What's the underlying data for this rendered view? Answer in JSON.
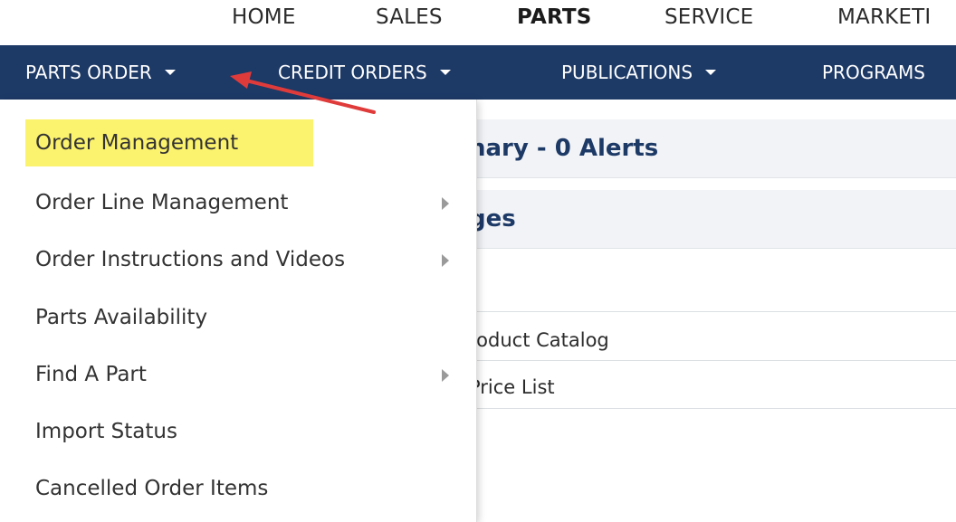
{
  "top_nav": {
    "items": [
      "HOME",
      "SALES",
      "PARTS",
      "SERVICE",
      "MARKETI"
    ],
    "active": "PARTS"
  },
  "sub_nav": {
    "items": [
      "PARTS ORDER",
      "CREDIT ORDERS",
      "PUBLICATIONS",
      "PROGRAMS"
    ]
  },
  "dropdown": {
    "items": [
      {
        "label": "Order Management",
        "has_submenu": false,
        "highlighted": true
      },
      {
        "label": "Order Line Management",
        "has_submenu": true
      },
      {
        "label": "Order Instructions and Videos",
        "has_submenu": true
      },
      {
        "label": "Parts Availability",
        "has_submenu": false
      },
      {
        "label": "Find A Part",
        "has_submenu": true
      },
      {
        "label": "Import Status",
        "has_submenu": false
      },
      {
        "label": "Cancelled Order Items",
        "has_submenu": false
      }
    ]
  },
  "background_content": {
    "summary_title_partial": "nary - 0 Alerts",
    "section_title_partial": "ges",
    "links": [
      "roduct Catalog",
      " Price List"
    ]
  },
  "colors": {
    "nav_bar": "#1d3966",
    "highlight": "#fbf26e",
    "annotation_arrow": "#e03b3b",
    "panel_header_bg": "#f1f3f6"
  }
}
